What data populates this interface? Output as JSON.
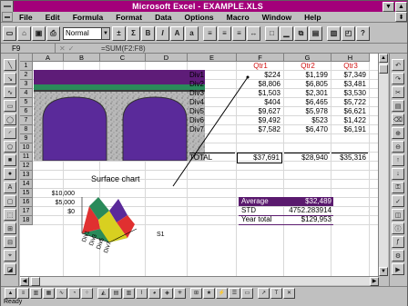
{
  "window": {
    "title": "Microsoft Excel - EXAMPLE.XLS"
  },
  "menu": [
    "File",
    "Edit",
    "Formula",
    "Format",
    "Data",
    "Options",
    "Macro",
    "Window",
    "Help"
  ],
  "toolbar": {
    "style_value": "Normal"
  },
  "formula_bar": {
    "cell_ref": "F9",
    "formula": "=SUM(F2:F8)"
  },
  "columns": [
    "A",
    "B",
    "C",
    "D",
    "E",
    "F",
    "G",
    "H"
  ],
  "rows": [
    "1",
    "2",
    "3",
    "4",
    "5",
    "6",
    "7",
    "8",
    "9",
    "10",
    "11",
    "12",
    "13",
    "14",
    "15",
    "16",
    "17",
    "18"
  ],
  "table": {
    "headers": [
      "Qtr1",
      "Qtr2",
      "Qtr3"
    ],
    "rows": [
      {
        "label": "Div1",
        "values": [
          "$224",
          "$1,199",
          "$7,349"
        ]
      },
      {
        "label": "Div2",
        "values": [
          "$8,806",
          "$6,805",
          "$3,481"
        ]
      },
      {
        "label": "Div3",
        "values": [
          "$1,503",
          "$2,301",
          "$3,530"
        ]
      },
      {
        "label": "Div4",
        "values": [
          "$404",
          "$6,465",
          "$5,722"
        ]
      },
      {
        "label": "Div5",
        "values": [
          "$9,627",
          "$5,978",
          "$6,621"
        ]
      },
      {
        "label": "Div6",
        "values": [
          "$9,492",
          "$523",
          "$1,422"
        ]
      },
      {
        "label": "Div7",
        "values": [
          "$7,582",
          "$6,470",
          "$6,191"
        ]
      }
    ],
    "total": {
      "label": "TOTAL",
      "values": [
        "$37,691",
        "$28,940",
        "$35,316"
      ]
    }
  },
  "stats": [
    {
      "label": "Average",
      "value": "$32,489"
    },
    {
      "label": "STD",
      "value": "4752.283914"
    },
    {
      "label": "Year total",
      "value": "$129,953"
    }
  ],
  "chart": {
    "title": "Surface chart",
    "y_ticks": [
      "$10,000",
      "$5,000",
      "$0"
    ],
    "x_ticks": [
      "Div1",
      "Div3",
      "Div5",
      "Div7"
    ],
    "series_label": "S1"
  },
  "status": {
    "text": "Ready"
  },
  "colors": {
    "titlebar": "#a3007a",
    "highlight": "#5a1a6e",
    "header_red": "#d01010"
  }
}
